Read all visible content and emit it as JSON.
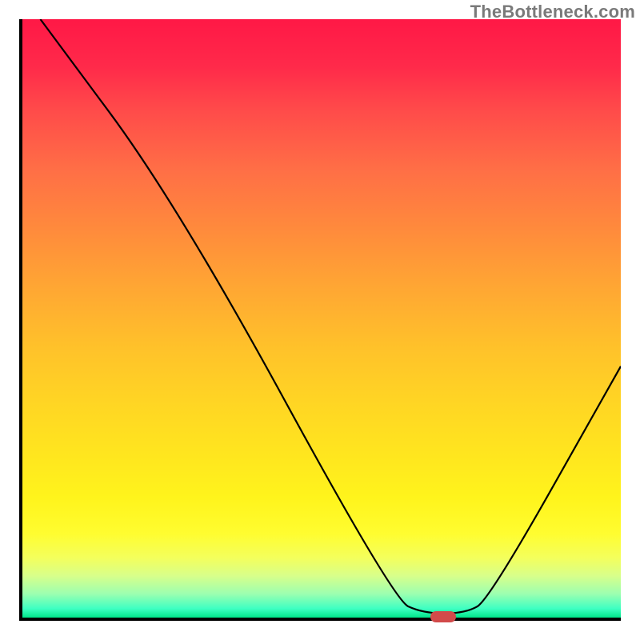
{
  "watermark": "TheBottleneck.com",
  "chart_data": {
    "type": "line",
    "title": "",
    "xlabel": "",
    "ylabel": "",
    "xlim": [
      0,
      100
    ],
    "ylim": [
      0,
      100
    ],
    "grid": false,
    "gradient_stops": [
      {
        "pct": 0,
        "color": "#ff1846"
      },
      {
        "pct": 50,
        "color": "#ffc22a"
      },
      {
        "pct": 86,
        "color": "#fffd30"
      },
      {
        "pct": 100,
        "color": "#00e58a"
      }
    ],
    "series": [
      {
        "name": "bottleneck-curve",
        "points": [
          {
            "x": 3,
            "y": 100
          },
          {
            "x": 26,
            "y": 69
          },
          {
            "x": 62,
            "y": 3
          },
          {
            "x": 67,
            "y": 0.7
          },
          {
            "x": 74,
            "y": 0.7
          },
          {
            "x": 78,
            "y": 3
          },
          {
            "x": 100,
            "y": 42
          }
        ]
      }
    ],
    "marker": {
      "x": 70,
      "y": 0.7,
      "color": "#d24a4a"
    }
  }
}
